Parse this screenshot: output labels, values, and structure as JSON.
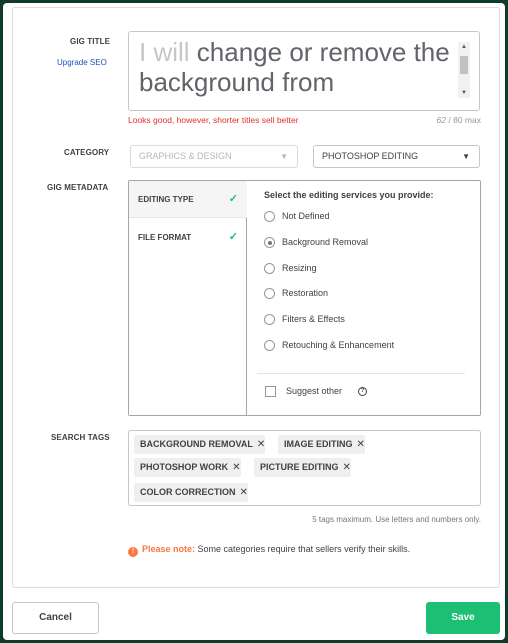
{
  "gig_title": {
    "label": "GIG TITLE",
    "upgrade_link": "Upgrade SEO",
    "placeholder_prefix": "I will",
    "value": "change or remove the background from",
    "hint": "Looks good, however, shorter titles sell better",
    "count_current": "62",
    "count_suffix": "/ 80 max"
  },
  "category": {
    "label": "CATEGORY",
    "primary": "GRAPHICS & DESIGN",
    "secondary": "PHOTOSHOP EDITING"
  },
  "gig_metadata": {
    "label": "GIG METADATA",
    "tabs": [
      {
        "label": "EDITING TYPE",
        "icon": "checkmark-icon"
      },
      {
        "label": "FILE FORMAT",
        "icon": "checkmark-icon"
      }
    ],
    "question": "Select the editing services you provide:",
    "options": [
      {
        "label": "Not Defined",
        "selected": false
      },
      {
        "label": "Background Removal",
        "selected": true
      },
      {
        "label": "Resizing",
        "selected": false
      },
      {
        "label": "Restoration",
        "selected": false
      },
      {
        "label": "Filters & Effects",
        "selected": false
      },
      {
        "label": "Retouching & Enhancement",
        "selected": false
      }
    ],
    "suggest_other": "Suggest other",
    "help_icon": "question-circle-icon"
  },
  "search_tags": {
    "label": "SEARCH TAGS",
    "tags": [
      "BACKGROUND REMOVAL",
      "IMAGE EDITING",
      "PHOTOSHOP WORK",
      "PICTURE EDITING",
      "COLOR CORRECTION"
    ],
    "remove_glyph": "✕",
    "hint": "5 tags maximum. Use letters and numbers only."
  },
  "note": {
    "icon": "warning-icon",
    "strong": "Please note:",
    "text": " Some categories require that sellers verify their skills."
  },
  "footer": {
    "cancel": "Cancel",
    "save": "Save"
  },
  "colors": {
    "accent": "#1dbf73",
    "error": "#e4302c",
    "warning": "#ff7640",
    "link": "#1e4dbf"
  }
}
